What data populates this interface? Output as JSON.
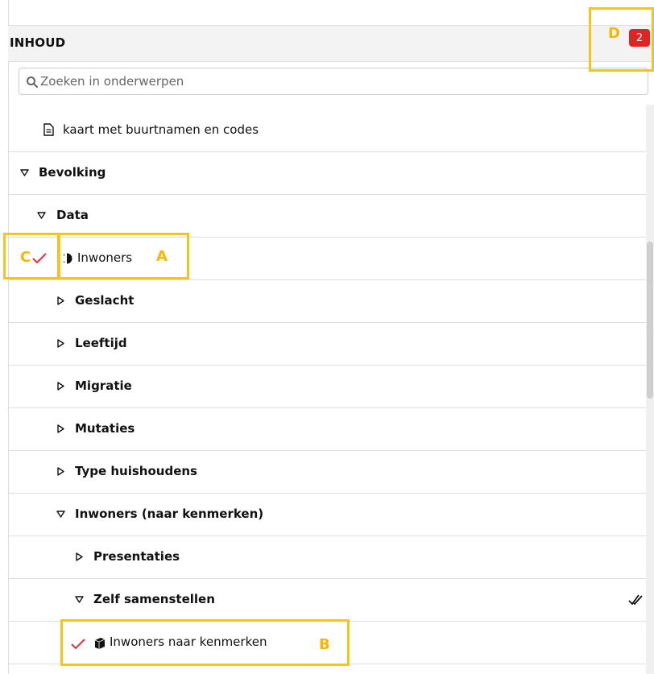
{
  "header": {
    "title": "INHOUD",
    "badge_count": "2"
  },
  "search": {
    "placeholder": "Zoeken in onderwerpen"
  },
  "tree": [
    {
      "label": "kaart met buurtnamen en codes",
      "type": "document"
    },
    {
      "label": "Bevolking",
      "state": "expanded"
    },
    {
      "label": "Data",
      "state": "expanded"
    },
    {
      "label": "Inwoners",
      "type": "half-circle",
      "checked": true
    },
    {
      "label": "Geslacht",
      "state": "collapsed"
    },
    {
      "label": "Leeftijd",
      "state": "collapsed"
    },
    {
      "label": "Migratie",
      "state": "collapsed"
    },
    {
      "label": "Mutaties",
      "state": "collapsed"
    },
    {
      "label": "Type huishoudens",
      "state": "collapsed"
    },
    {
      "label": "Inwoners (naar kenmerken)",
      "state": "expanded"
    },
    {
      "label": "Presentaties",
      "state": "collapsed"
    },
    {
      "label": "Zelf samenstellen",
      "state": "expanded",
      "trailing_icon": "double-check-icon"
    },
    {
      "label": "Inwoners naar kenmerken",
      "type": "cube",
      "checked": true
    }
  ],
  "annotations": {
    "a": "A",
    "b": "B",
    "c": "C",
    "d": "D"
  },
  "colors": {
    "accent_check": "#e0303a",
    "annotation": "#f5c518",
    "badge": "#e02424"
  }
}
